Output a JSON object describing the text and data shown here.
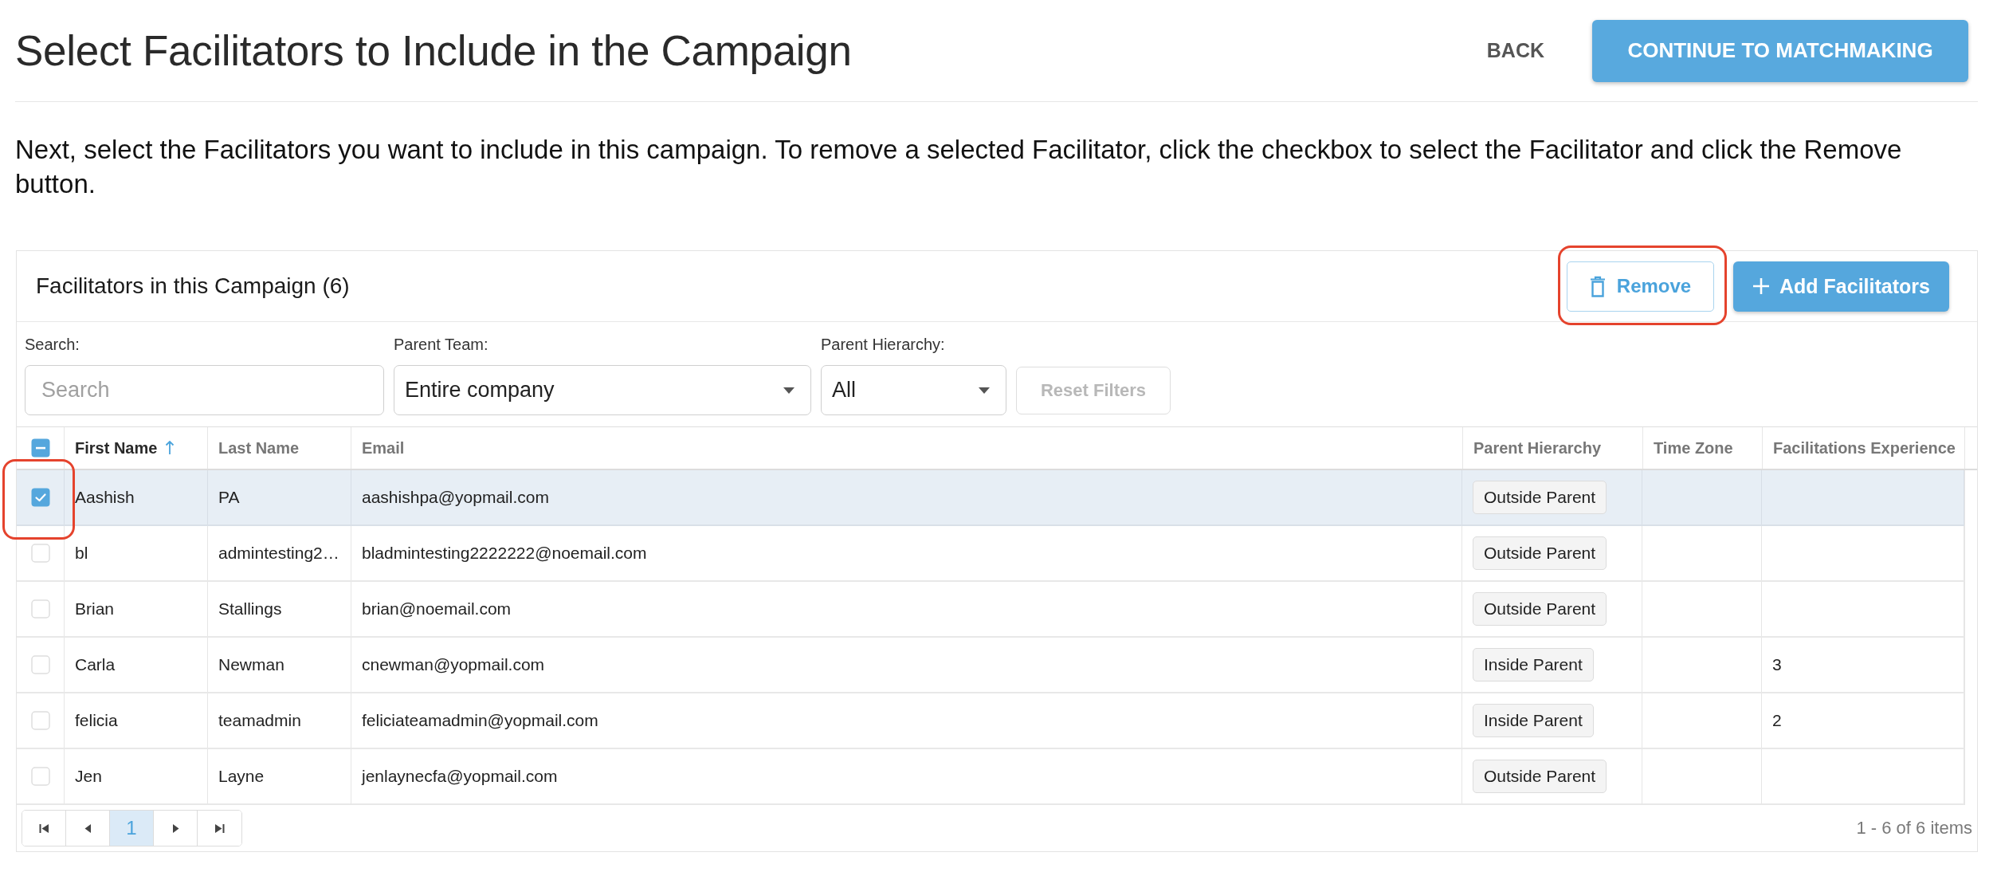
{
  "header": {
    "title": "Select Facilitators to Include in the Campaign",
    "back_button": "BACK",
    "continue_button": "CONTINUE TO MATCHMAKING"
  },
  "instructions": "Next, select the Facilitators you want to include in this campaign. To remove a selected Facilitator, click the checkbox to select the Facilitator and click the Remove button.",
  "panel": {
    "title": "Facilitators in this Campaign (6)",
    "remove_button": {
      "label": "Remove",
      "highlighted": true
    },
    "add_button": "Add Facilitators",
    "filters": [
      {
        "kind": "search",
        "label": "Search:",
        "placeholder": "Search"
      },
      {
        "kind": "dropdown",
        "label": "Parent Team:",
        "value": "Entire company"
      },
      {
        "kind": "dropdown",
        "label": "Parent Hierarchy:",
        "value": "All"
      }
    ],
    "reset_button": {
      "label": "Reset Filters",
      "disabled": true
    }
  },
  "table": {
    "select_all": {
      "indeterminate": true
    },
    "columns": [
      {
        "label": "First Name",
        "sorted": true
      },
      {
        "label": "Last Name",
        "sorted": false
      },
      {
        "label": "Email",
        "sorted": false
      },
      {
        "label": "Parent Hierarchy",
        "sorted": false
      },
      {
        "label": "Time Zone",
        "sorted": false
      },
      {
        "label": "Facilitations Experience",
        "sorted": false
      }
    ],
    "rows": [
      {
        "selected": true,
        "highlighted": true,
        "first_name": "Aashish",
        "last_name": "PA",
        "email": "aashishpa@yopmail.com",
        "parent_hierarchy": "Outside Parent"
      },
      {
        "selected": false,
        "highlighted": false,
        "first_name": "bl",
        "last_name": "admintesting2…",
        "email": "bladmintesting2222222@noemail.com",
        "parent_hierarchy": "Outside Parent"
      },
      {
        "selected": false,
        "highlighted": false,
        "first_name": "Brian",
        "last_name": "Stallings",
        "email": "brian@noemail.com",
        "parent_hierarchy": "Outside Parent"
      },
      {
        "selected": false,
        "highlighted": false,
        "first_name": "Carla",
        "last_name": "Newman",
        "email": "cnewman@yopmail.com",
        "parent_hierarchy": "Inside Parent",
        "facilitations_experience": "3"
      },
      {
        "selected": false,
        "highlighted": false,
        "first_name": "felicia",
        "last_name": "teamadmin",
        "email": "feliciateamadmin@yopmail.com",
        "parent_hierarchy": "Inside Parent",
        "facilitations_experience": "2"
      },
      {
        "selected": false,
        "highlighted": false,
        "first_name": "Jen",
        "last_name": "Layne",
        "email": "jenlaynecfa@yopmail.com",
        "parent_hierarchy": "Outside Parent"
      }
    ]
  },
  "pager": {
    "pages": [
      {
        "label": "1",
        "selected": true
      }
    ],
    "summary": "1 - 6 of 6 items"
  }
}
